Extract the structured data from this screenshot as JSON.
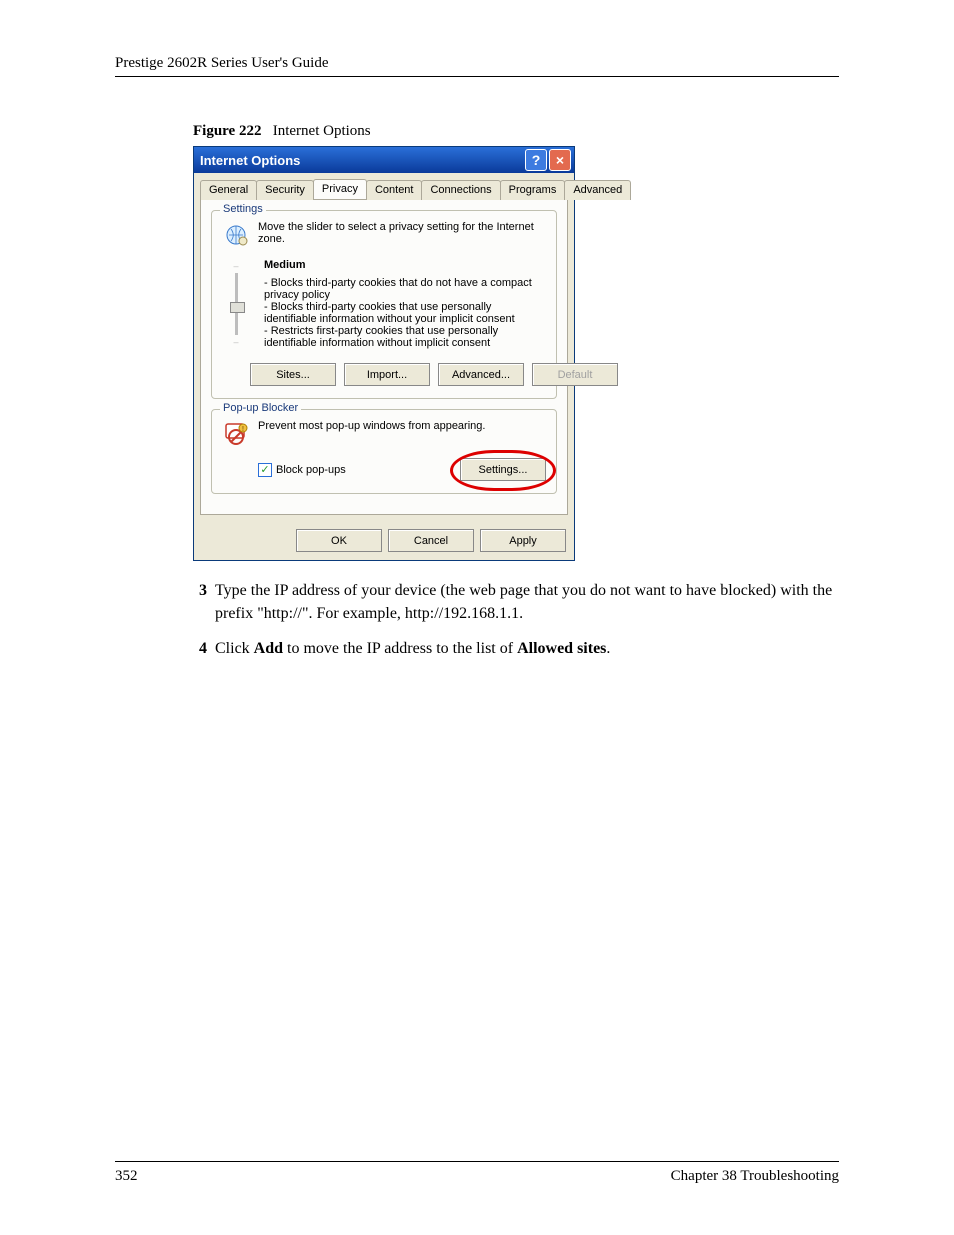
{
  "document": {
    "header": "Prestige 2602R Series User's Guide",
    "figure_label": "Figure 222",
    "figure_title": "Internet Options",
    "page_number": "352",
    "chapter": "Chapter 38 Troubleshooting"
  },
  "dialog": {
    "title": "Internet Options",
    "help_symbol": "?",
    "close_symbol": "×",
    "tabs": [
      "General",
      "Security",
      "Privacy",
      "Content",
      "Connections",
      "Programs",
      "Advanced"
    ],
    "active_tab_index": 2,
    "settings": {
      "legend": "Settings",
      "instruction": "Move the slider to select a privacy setting for the Internet zone.",
      "level_name": "Medium",
      "bullets": [
        "- Blocks third-party cookies that do not have a compact privacy policy",
        "- Blocks third-party cookies that use personally identifiable information without your implicit consent",
        "- Restricts first-party cookies that use personally identifiable information without implicit consent"
      ],
      "buttons": {
        "sites": "Sites...",
        "import": "Import...",
        "advanced": "Advanced...",
        "default": "Default"
      }
    },
    "popup": {
      "legend": "Pop-up Blocker",
      "instruction": "Prevent most pop-up windows from appearing.",
      "checkbox_label": "Block pop-ups",
      "checkbox_checked": "✓",
      "settings_button": "Settings..."
    },
    "footer_buttons": {
      "ok": "OK",
      "cancel": "Cancel",
      "apply": "Apply"
    }
  },
  "steps": {
    "s3_num": "3",
    "s3_text_a": "Type the IP address of your device (the web page that you do not want to have blocked) with the prefix \"http://\". For example, http://192.168.1.1.",
    "s4_num": "4",
    "s4_prefix": "Click ",
    "s4_b1": "Add",
    "s4_mid": " to move the IP address to the list of ",
    "s4_b2": "Allowed sites",
    "s4_suffix": "."
  }
}
